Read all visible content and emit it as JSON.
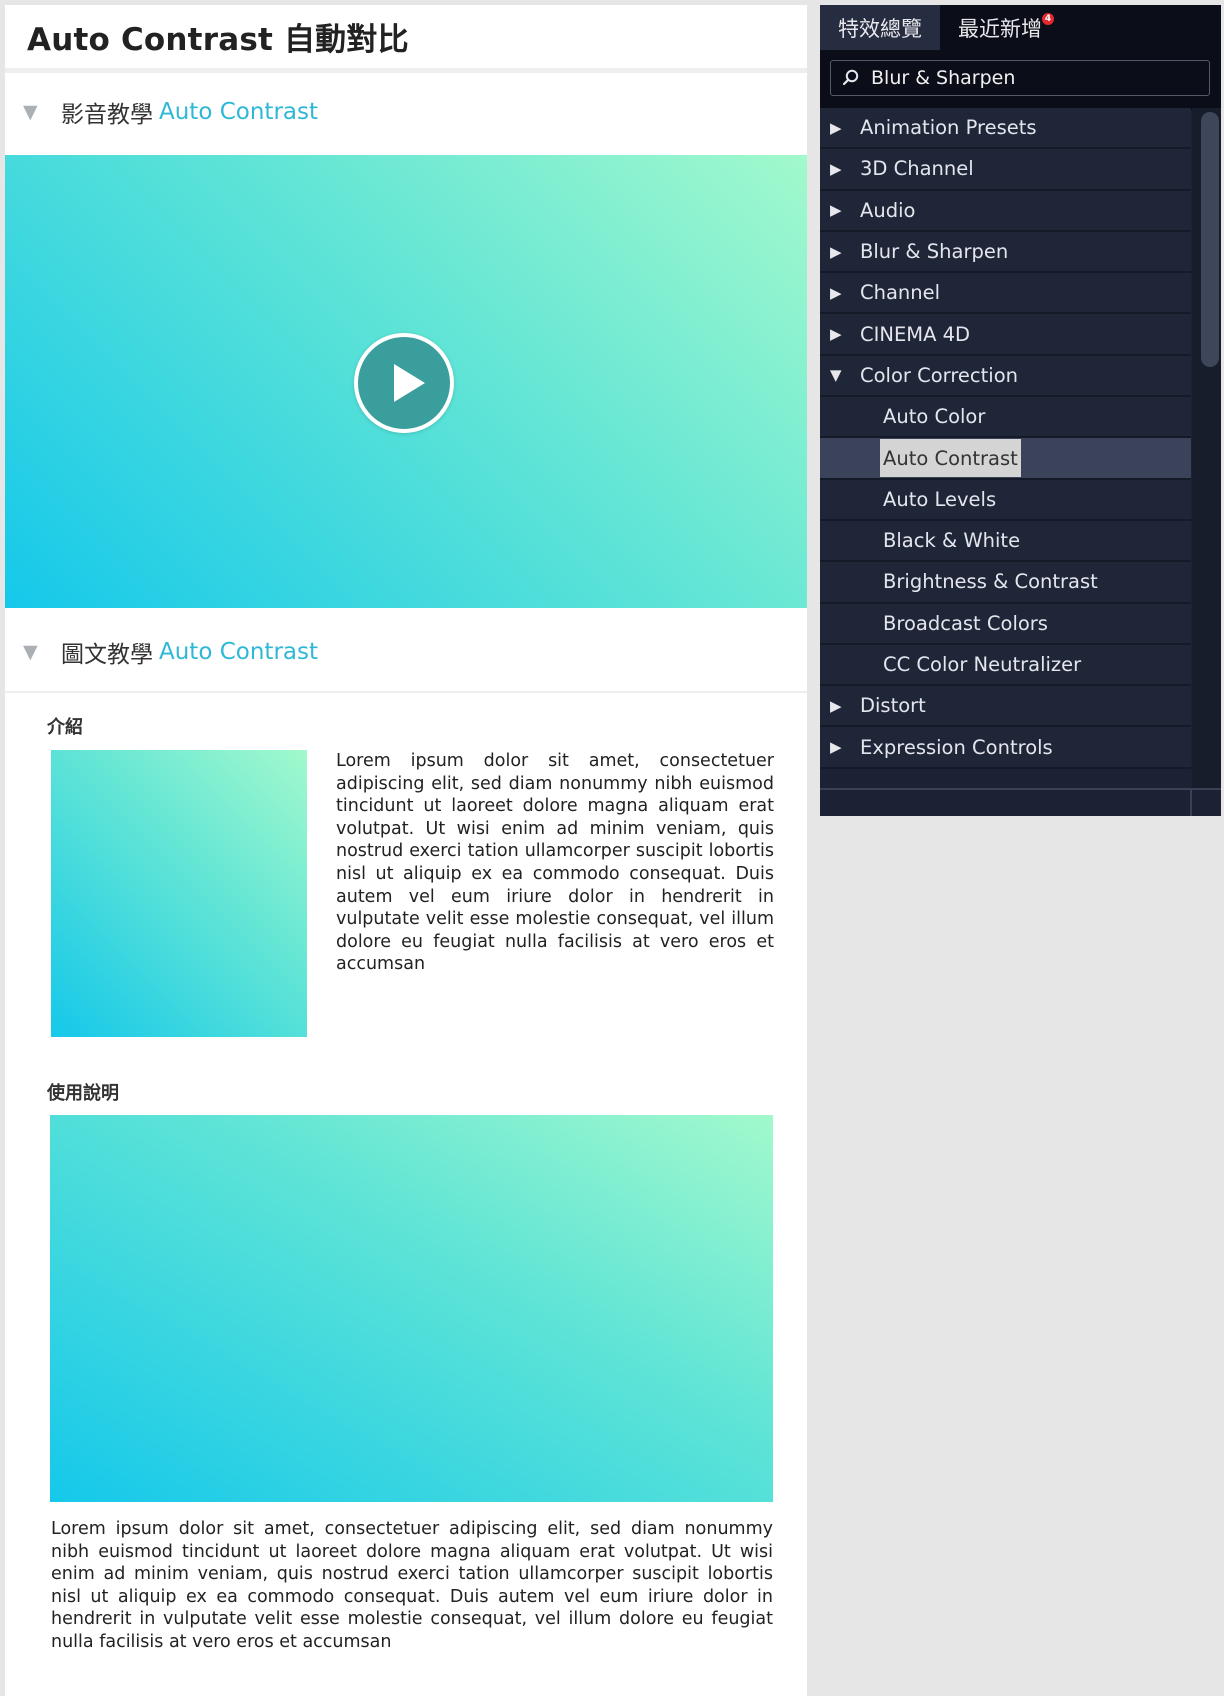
{
  "page": {
    "title": "Auto Contrast  自動對比",
    "video_section": {
      "prefix": "影音教學",
      "accent": "Auto Contrast"
    },
    "article_section": {
      "prefix": "圖文教學",
      "accent": "Auto Contrast"
    },
    "intro_label": "介紹",
    "intro_text": "Lorem ipsum dolor sit amet, consectetuer adipiscing elit, sed diam nonummy nibh euismod tincidunt ut laoreet dolore magna aliquam erat volutpat. Ut wisi enim ad minim veniam, quis nostrud exerci tation ullamcorper suscipit lobortis nisl ut aliquip ex ea commodo consequat. Duis autem vel eum iriure dolor in hendrerit in vulputate velit esse molestie consequat, vel illum dolore eu feugiat nulla facilisis at vero eros et accumsan",
    "usage_label": "使用說明",
    "usage_text": "Lorem ipsum dolor sit amet, consectetuer adipiscing elit, sed diam nonummy nibh euismod tincidunt ut laoreet dolore magna aliquam erat volutpat. Ut wisi enim ad minim veniam, quis nostrud exerci tation ullamcorper suscipit lobortis nisl ut aliquip ex ea commodo consequat. Duis autem vel eum iriure dolor in hendrerit in vulputate velit esse molestie consequat, vel illum dolore eu feugiat nulla facilisis at vero eros et accumsan"
  },
  "panel": {
    "tabs": [
      {
        "label": "特效總覽",
        "active": true
      },
      {
        "label": "最近新增",
        "badge": "4"
      }
    ],
    "search": {
      "value": "Blur & Sharpen"
    },
    "tree": [
      {
        "label": "Animation Presets",
        "level": 0,
        "expanded": false
      },
      {
        "label": "3D Channel",
        "level": 0,
        "expanded": false
      },
      {
        "label": "Audio",
        "level": 0,
        "expanded": false
      },
      {
        "label": "Blur & Sharpen",
        "level": 0,
        "expanded": false
      },
      {
        "label": "Channel",
        "level": 0,
        "expanded": false
      },
      {
        "label": "CINEMA 4D",
        "level": 0,
        "expanded": false
      },
      {
        "label": "Color Correction",
        "level": 0,
        "expanded": true
      },
      {
        "label": "Auto Color",
        "level": 1
      },
      {
        "label": "Auto Contrast",
        "level": 1,
        "selected": true
      },
      {
        "label": "Auto Levels",
        "level": 1
      },
      {
        "label": "Black & White",
        "level": 1
      },
      {
        "label": "Brightness & Contrast",
        "level": 1
      },
      {
        "label": "Broadcast Colors",
        "level": 1
      },
      {
        "label": "CC Color Neutralizer",
        "level": 1
      },
      {
        "label": "Distort",
        "level": 0,
        "expanded": false
      },
      {
        "label": "Expression Controls",
        "level": 0,
        "expanded": false
      }
    ]
  },
  "colors": {
    "accent": "#2eb8d6",
    "panel_bg": "#1c2233",
    "selection_bg": "#3b435a",
    "badge": "#e6292f"
  }
}
